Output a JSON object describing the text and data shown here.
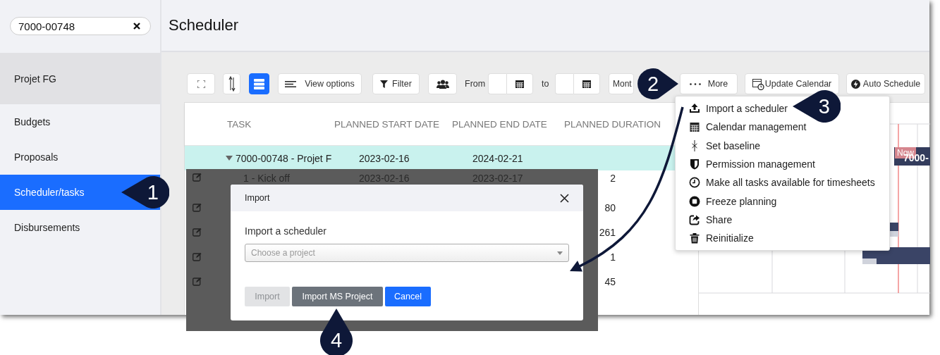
{
  "search": {
    "value": "7000-00748"
  },
  "page_title": "Scheduler",
  "sidebar": {
    "items": [
      {
        "label": "Projet FG",
        "kind": "project",
        "selected": false
      },
      {
        "label": "Budgets",
        "kind": "link",
        "selected": false
      },
      {
        "label": "Proposals",
        "kind": "link",
        "selected": false
      },
      {
        "label": "Scheduler/tasks",
        "kind": "link",
        "selected": true
      },
      {
        "label": "Disbursements",
        "kind": "link",
        "selected": false
      }
    ]
  },
  "toolbar": {
    "icon_buttons": [
      {
        "kind": "expand",
        "selected": false
      },
      {
        "kind": "sort",
        "selected": false
      },
      {
        "kind": "rows",
        "selected": true
      }
    ],
    "view_options": "View options",
    "filter": "Filter",
    "from_label": "From",
    "to_label": "to",
    "period": "Mont",
    "more": "More",
    "update_calendar": "Update Calendar",
    "auto_schedule": "Auto Schedule"
  },
  "table": {
    "columns": [
      "TASK",
      "PLANNED START DATE",
      "PLANNED END DATE",
      "PLANNED DURATION"
    ],
    "rows": [
      {
        "task": "7000-00748 - Projet F",
        "start": "2023-02-16",
        "end": "2024-02-21",
        "expanded": true,
        "highlighted": true
      },
      {
        "task": "1 - Kick off",
        "start": "2023-02-16",
        "end": "2023-02-17",
        "duration": "2",
        "highlighted": false
      },
      {
        "duration": "80",
        "highlighted": false
      },
      {
        "duration": "261",
        "highlighted": false
      },
      {
        "duration": "1",
        "highlighted": false
      },
      {
        "duration": "45",
        "highlighted": false
      }
    ]
  },
  "gantt": {
    "now_label": "Now",
    "bar_label": "7000-"
  },
  "dialog": {
    "title": "Import",
    "label": "Import a scheduler",
    "select": {
      "placeholder": "Choose a project"
    },
    "buttons": [
      {
        "label": "Import",
        "kind": "plain",
        "disabled": true
      },
      {
        "label": "Import MS Project",
        "kind": "secondary",
        "disabled": false
      },
      {
        "label": "Cancel",
        "kind": "primary",
        "disabled": false
      }
    ]
  },
  "menu": {
    "items": [
      {
        "label": "Import a scheduler",
        "kind": "upload"
      },
      {
        "label": "Calendar management",
        "kind": "calendar"
      },
      {
        "label": "Set baseline",
        "kind": "baseline"
      },
      {
        "label": "Permission management",
        "kind": "shield"
      },
      {
        "label": "Make all tasks available for timesheets",
        "kind": "clock"
      },
      {
        "label": "Freeze planning",
        "kind": "stop"
      },
      {
        "label": "Share",
        "kind": "share"
      },
      {
        "label": "Reinitialize",
        "kind": "trash"
      }
    ]
  },
  "callouts": [
    {
      "number": "1",
      "kind": "left"
    },
    {
      "number": "2",
      "kind": "right"
    },
    {
      "number": "3",
      "kind": "left"
    },
    {
      "number": "4",
      "kind": "up"
    }
  ]
}
